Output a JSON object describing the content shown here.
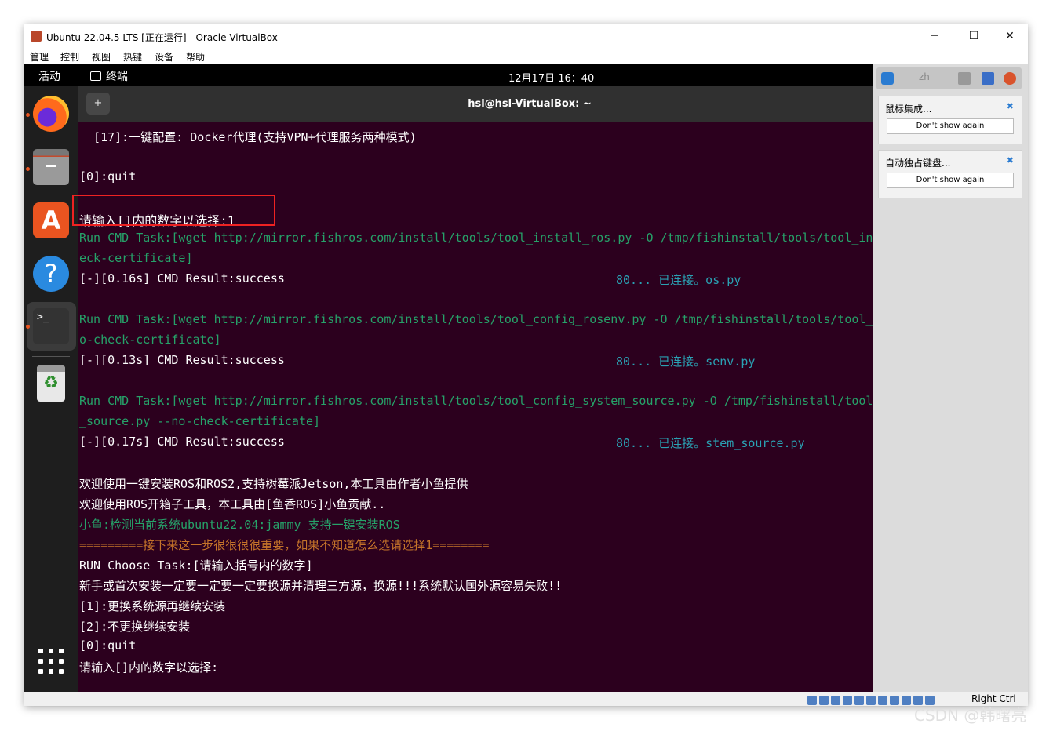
{
  "window": {
    "title": "Ubuntu 22.04.5 LTS [正在运行] - Oracle VirtualBox",
    "minimize": "─",
    "maximize": "☐",
    "close": "✕"
  },
  "menu": [
    "管理",
    "控制",
    "视图",
    "热键",
    "设备",
    "帮助"
  ],
  "topbar": {
    "activities": "活动",
    "app": "终端",
    "clock": "12月17日 16：40"
  },
  "dock": {
    "help_glyph": "?",
    "store_glyph": "A",
    "terminal_glyph": ">_",
    "trash_glyph": "♻"
  },
  "terminal": {
    "title": "hsl@hsl-VirtualBox: ~",
    "newtab_glyph": "+",
    "lines": [
      "  [17]:一键配置: Docker代理(支持VPN+代理服务两种模式)",
      "[0]:quit",
      "请输入[]内的数字以选择:1",
      "Run CMD Task:[wget http://mirror.fishros.com/install/tools/tool_install_ros.py -O /tmp/fishinstall/tools/tool_install_ros.py --no-ch",
      "eck-certificate]",
      "[-][0.16s] CMD Result:success",
      "80... 已连接。os.py",
      "Run CMD Task:[wget http://mirror.fishros.com/install/tools/tool_config_rosenv.py -O /tmp/fishinstall/tools/tool_config_rosenv.py --n",
      "o-check-certificate]",
      "[-][0.13s] CMD Result:success",
      "80... 已连接。senv.py",
      "Run CMD Task:[wget http://mirror.fishros.com/install/tools/tool_config_system_source.py -O /tmp/fishinstall/tools/tool_config_system",
      "_source.py --no-check-certificate]",
      "[-][0.17s] CMD Result:success",
      "80... 已连接。stem_source.py",
      "欢迎使用一键安装ROS和ROS2,支持树莓派Jetson,本工具由作者小鱼提供",
      "欢迎使用ROS开箱子工具，本工具由[鱼香ROS]小鱼贡献..",
      "小鱼:检测当前系统ubuntu22.04:jammy 支持一键安装ROS",
      "=========接下来这一步很很很很重要，如果不知道怎么选请选择1========",
      "RUN Choose Task:[请输入括号内的数字]",
      "新手或首次安装一定要一定要一定要换源并清理三方源，换源!!!系统默认国外源容易失败!!",
      "[1]:更换系统源再继续安装",
      "[2]:不更换继续安装",
      "[0]:quit",
      "请输入[]内的数字以选择:"
    ]
  },
  "notices": [
    {
      "title": "鼠标集成...",
      "button": "Don't show again",
      "close": "✖"
    },
    {
      "title": "自动独占键盘...",
      "button": "Don't show again",
      "close": "✖"
    }
  ],
  "panel_label": "zh",
  "status": {
    "host_key": "Right Ctrl"
  },
  "watermark": "CSDN @韩曙亮",
  "colors": {
    "terminal_bg": "#2c001e",
    "success_green": "#26a269",
    "warn_orange": "#c4732a",
    "highlight_red": "#ee2222"
  }
}
